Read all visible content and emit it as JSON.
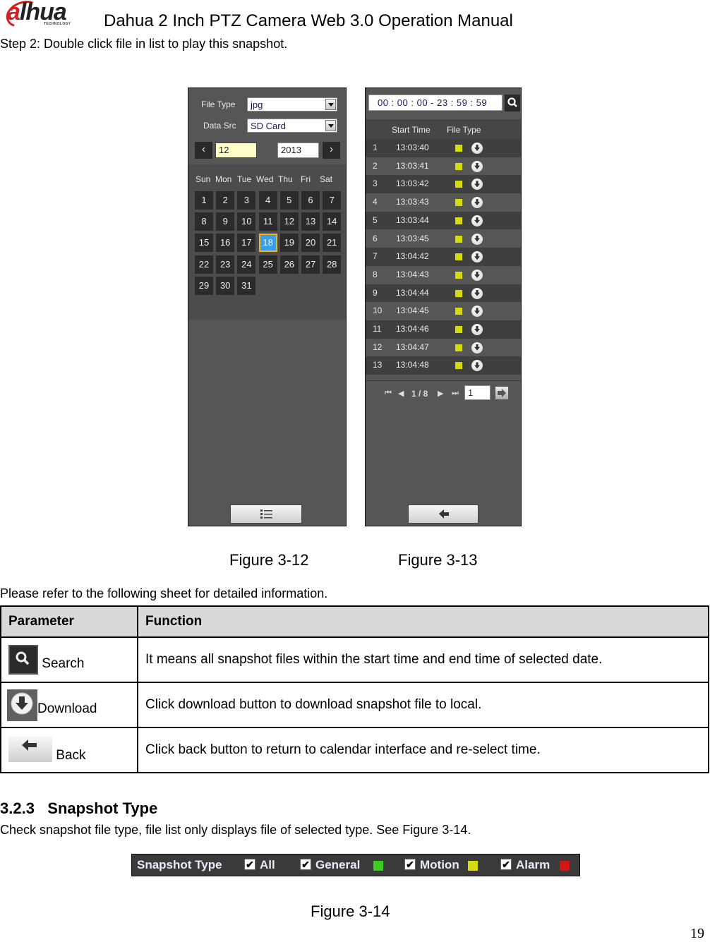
{
  "header": {
    "logo_text": "alhua",
    "logo_subtext": "TECHNOLOGY",
    "doc_title": "Dahua 2 Inch PTZ Camera Web 3.0 Operation Manual"
  },
  "step2_text": "Step 2: Double click file in list to play this snapshot.",
  "figure_3_12": {
    "file_type_label": "File Type",
    "file_type_value": "jpg",
    "data_src_label": "Data Src",
    "data_src_value": "SD Card",
    "prev_icon": "chevron-left-icon",
    "next_icon": "chevron-right-icon",
    "month_value": "12",
    "year_value": "2013",
    "weekdays": [
      "Sun",
      "Mon",
      "Tue",
      "Wed",
      "Thu",
      "Fri",
      "Sat"
    ],
    "days": [
      "1",
      "2",
      "3",
      "4",
      "5",
      "6",
      "7",
      "8",
      "9",
      "10",
      "11",
      "12",
      "13",
      "14",
      "15",
      "16",
      "17",
      "18",
      "19",
      "20",
      "21",
      "22",
      "23",
      "24",
      "25",
      "26",
      "27",
      "28",
      "29",
      "30",
      "31"
    ],
    "selected_day": "18",
    "footer_button_icon": "list-icon"
  },
  "figure_3_13": {
    "time_range": "00 : 00 : 00 - 23 : 59 : 59",
    "search_icon": "search-icon",
    "columns": [
      "Start Time",
      "File Type"
    ],
    "rows": [
      {
        "no": "1",
        "time": "13:03:40"
      },
      {
        "no": "2",
        "time": "13:03:41"
      },
      {
        "no": "3",
        "time": "13:03:42"
      },
      {
        "no": "4",
        "time": "13:03:43"
      },
      {
        "no": "5",
        "time": "13:03:44"
      },
      {
        "no": "6",
        "time": "13:03:45"
      },
      {
        "no": "7",
        "time": "13:04:42"
      },
      {
        "no": "8",
        "time": "13:04:43"
      },
      {
        "no": "9",
        "time": "13:04:44"
      },
      {
        "no": "10",
        "time": "13:04:45"
      },
      {
        "no": "11",
        "time": "13:04:46"
      },
      {
        "no": "12",
        "time": "13:04:47"
      },
      {
        "no": "13",
        "time": "13:04:48"
      }
    ],
    "file_type_color": "#d6dc0a",
    "pager_text": "1 / 8",
    "page_input_value": "1",
    "footer_button_icon": "back-arrow-icon"
  },
  "captions": {
    "fig12": "Figure 3-12",
    "fig13": "Figure 3-13",
    "fig14": "Figure 3-14"
  },
  "sheet_intro": "Please refer to the following sheet for detailed information.",
  "param_table": {
    "headers": [
      "Parameter",
      "Function"
    ],
    "rows": [
      {
        "icon": "search-icon",
        "param": "Search",
        "function": "It means all snapshot files within the start time and end time of selected date."
      },
      {
        "icon": "download-icon",
        "param": "Download",
        "function": "Click download button to download snapshot file to local."
      },
      {
        "icon": "back-arrow-icon",
        "param": "Back",
        "function": "Click back button to return to calendar interface and re-select time."
      }
    ]
  },
  "section": {
    "heading": "3.2.3   Snapshot Type",
    "text": "Check snapshot file type, file list only displays file of selected type. See Figure 3-14."
  },
  "snapshot_type_bar": {
    "label": "Snapshot Type",
    "options": [
      {
        "label": "All",
        "checked": true
      },
      {
        "label": "General",
        "checked": true,
        "color": "#3ccc1e"
      },
      {
        "label": "Motion",
        "checked": true,
        "color": "#d6dc0a"
      },
      {
        "label": "Alarm",
        "checked": true,
        "color": "#d41414"
      }
    ]
  },
  "page_number": "19"
}
